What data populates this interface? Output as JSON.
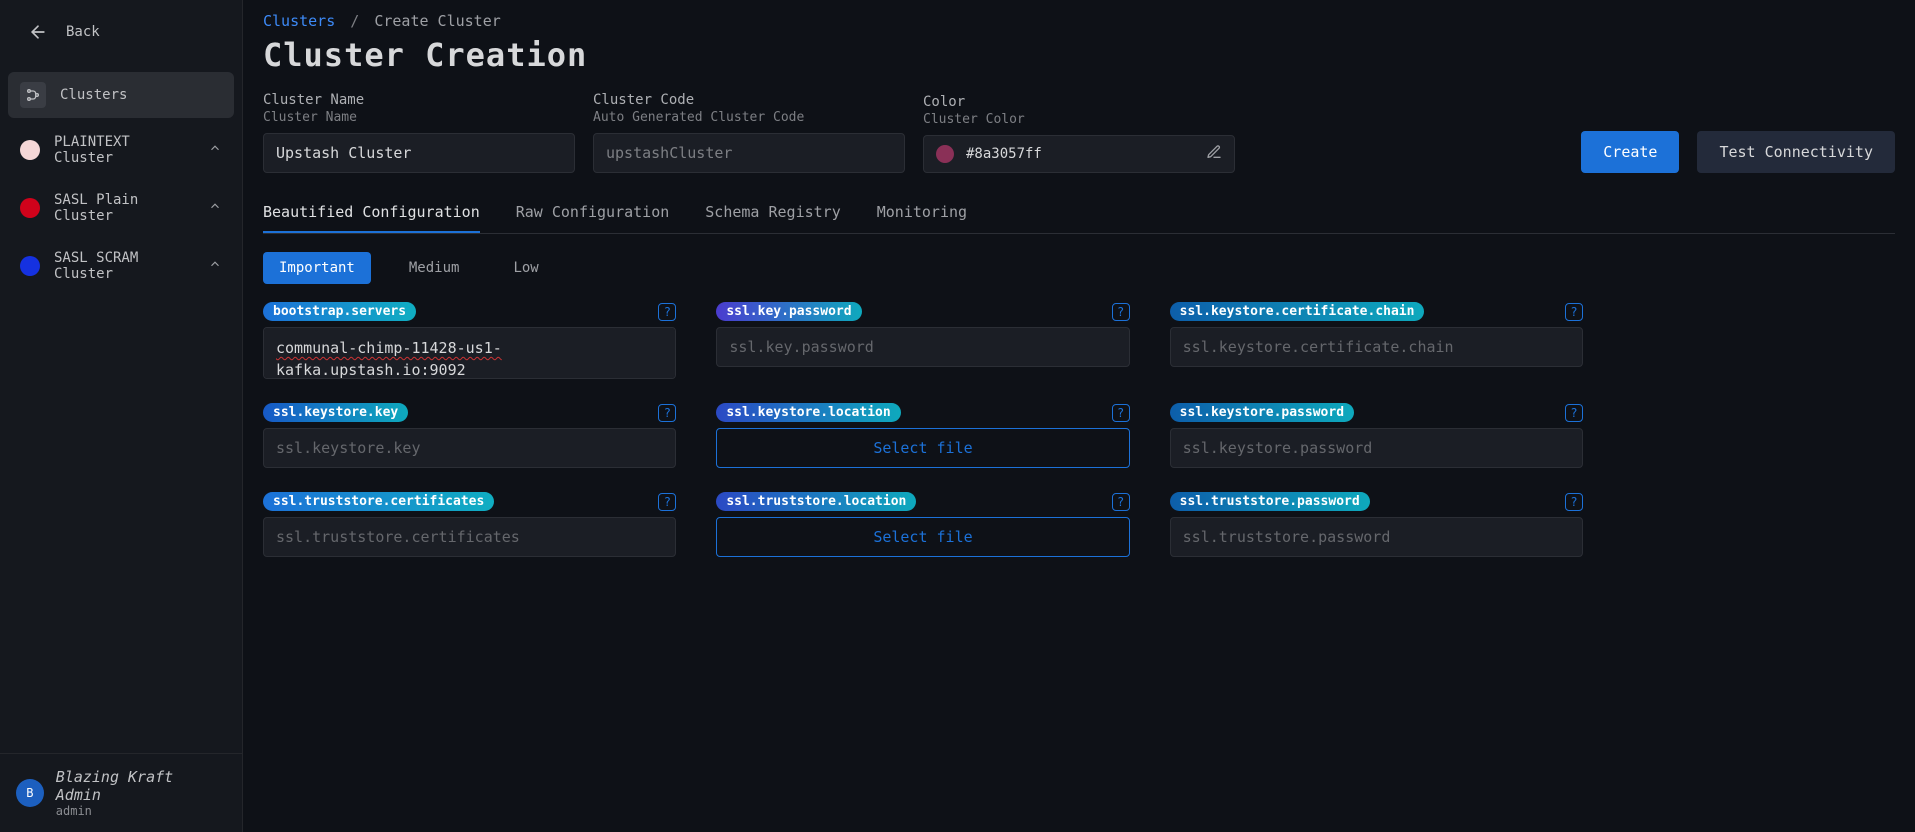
{
  "sidebar": {
    "back_label": "Back",
    "clusters_label": "Clusters",
    "items": [
      {
        "label": "PLAINTEXT Cluster",
        "dot": "#f5d7d7"
      },
      {
        "label": "SASL Plain Cluster",
        "dot": "#d0021b"
      },
      {
        "label": "SASL SCRAM Cluster",
        "dot": "#1531e0"
      }
    ],
    "user": {
      "name": "Blazing Kraft Admin",
      "sub": "admin",
      "initial": "B"
    }
  },
  "breadcrumb": {
    "root": "Clusters",
    "current": "Create Cluster"
  },
  "page_title": "Cluster Creation",
  "fields": {
    "name": {
      "label": "Cluster Name",
      "desc": "Cluster Name",
      "value": "Upstash Cluster"
    },
    "code": {
      "label": "Cluster Code",
      "desc": "Auto Generated Cluster Code",
      "value": "upstashCluster"
    },
    "color": {
      "label": "Color",
      "desc": "Cluster Color",
      "hex": "#8a3057ff",
      "swatch": "#8a3057"
    }
  },
  "actions": {
    "create": "Create",
    "test": "Test Connectivity"
  },
  "tabs": [
    "Beautified Configuration",
    "Raw Configuration",
    "Schema Registry",
    "Monitoring"
  ],
  "active_tab": 0,
  "importance": {
    "options": [
      "Important",
      "Medium",
      "Low"
    ],
    "active": 0
  },
  "config": [
    {
      "key": "bootstrap.servers",
      "placeholder": "bootstrap.servers",
      "value": "communal-chimp-11428-us1-kafka.upstash.io:9092",
      "kind": "textarea",
      "grad": "grad-blue"
    },
    {
      "key": "ssl.key.password",
      "placeholder": "ssl.key.password",
      "value": "",
      "kind": "input",
      "grad": "grad-purple"
    },
    {
      "key": "ssl.keystore.certificate.chain",
      "placeholder": "ssl.keystore.certificate.chain",
      "value": "",
      "kind": "input",
      "grad": "grad-teal"
    },
    {
      "key": "ssl.keystore.key",
      "placeholder": "ssl.keystore.key",
      "value": "",
      "kind": "input",
      "grad": "grad-bluecyan"
    },
    {
      "key": "ssl.keystore.location",
      "placeholder": "",
      "value": "",
      "kind": "file",
      "file_label": "Select file",
      "grad": "grad-indigo"
    },
    {
      "key": "ssl.keystore.password",
      "placeholder": "ssl.keystore.password",
      "value": "",
      "kind": "input",
      "grad": "grad-teal"
    },
    {
      "key": "ssl.truststore.certificates",
      "placeholder": "ssl.truststore.certificates",
      "value": "",
      "kind": "input",
      "grad": "grad-blue"
    },
    {
      "key": "ssl.truststore.location",
      "placeholder": "",
      "value": "",
      "kind": "file",
      "file_label": "Select file",
      "grad": "grad-indigo"
    },
    {
      "key": "ssl.truststore.password",
      "placeholder": "ssl.truststore.password",
      "value": "",
      "kind": "input",
      "grad": "grad-teal"
    }
  ]
}
